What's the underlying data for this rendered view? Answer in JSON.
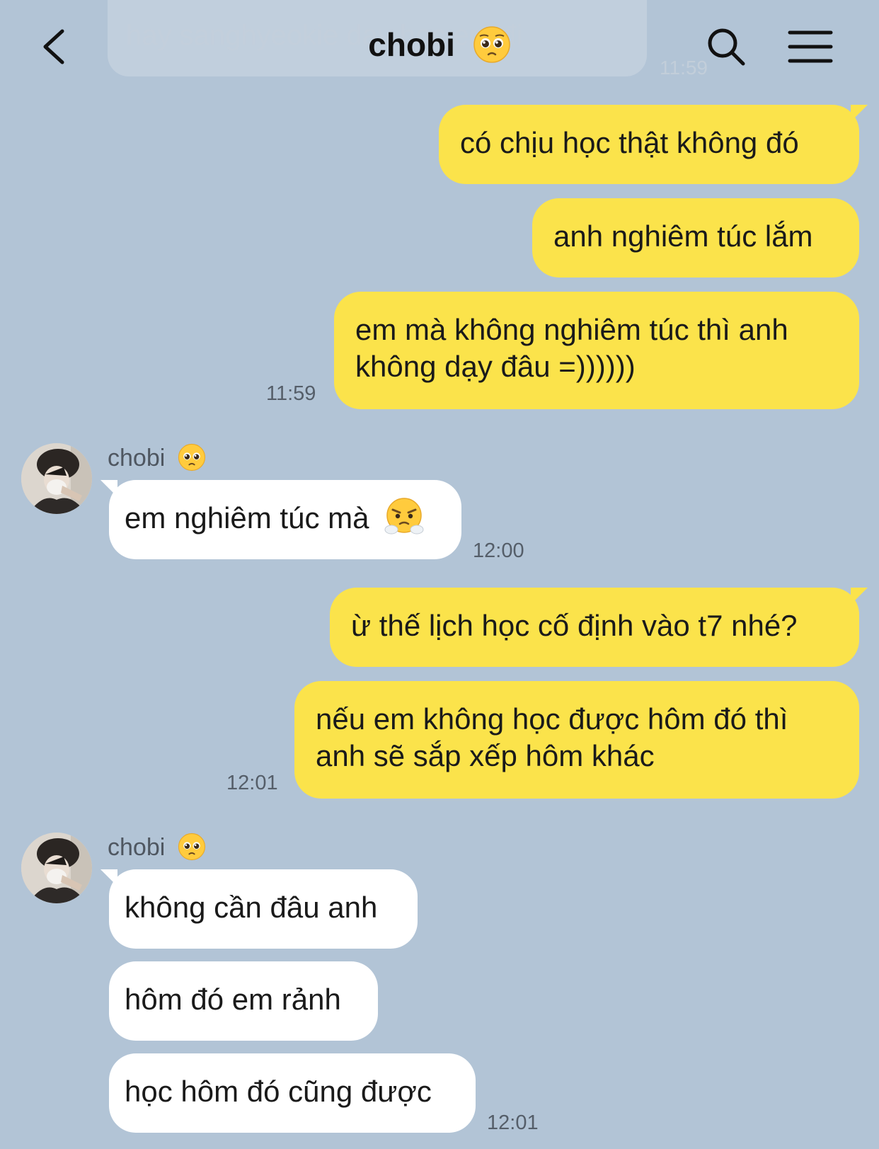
{
  "header": {
    "title": "chobi",
    "ghost_preview": "hay sanghyeokie dạy học em đi",
    "ghost_time": "11:59"
  },
  "contact": {
    "name": "chobi"
  },
  "messages": [
    {
      "from": "me",
      "text": "có chịu học thật không đó"
    },
    {
      "from": "me",
      "text": "anh nghiêm túc lắm"
    },
    {
      "from": "me",
      "line1": "em mà không nghiêm túc thì anh",
      "line2": "không dạy đâu =))))))",
      "time": "11:59"
    },
    {
      "from": "them",
      "text": "em nghiêm túc mà",
      "time": "12:00"
    },
    {
      "from": "me",
      "text": "ừ thế lịch học cố định vào t7 nhé?"
    },
    {
      "from": "me",
      "line1": "nếu em không học được hôm đó thì",
      "line2": "anh sẽ sắp xếp hôm khác",
      "time": "12:01"
    },
    {
      "from": "them",
      "text": "không cần đâu anh"
    },
    {
      "from": "them",
      "text": "hôm đó em rảnh"
    },
    {
      "from": "them",
      "text": "học hôm đó cũng được",
      "time": "12:01"
    }
  ],
  "icons": {
    "back": "chevron-left-icon",
    "search": "search-icon",
    "menu": "hamburger-menu-icon",
    "pleading": "pleading-face-emoji",
    "huffing": "face-with-steam-emoji"
  },
  "colors": {
    "background": "#b2c4d6",
    "sent_bubble": "#fbe34b",
    "received_bubble": "#ffffff"
  }
}
